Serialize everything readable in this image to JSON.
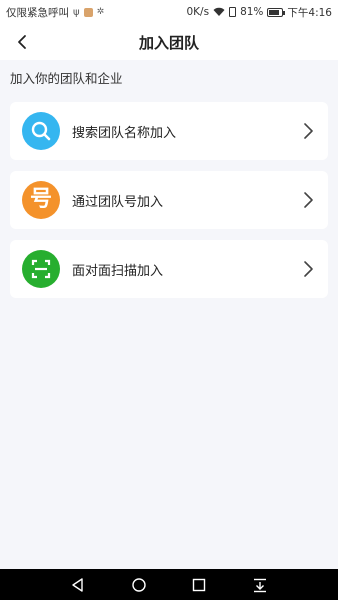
{
  "status_bar": {
    "carrier_text": "仅限紧急呼叫",
    "net_speed": "0K/s",
    "battery_percent": "81%",
    "time": "下午4:16"
  },
  "header": {
    "title": "加入团队"
  },
  "section": {
    "label": "加入你的团队和企业"
  },
  "options": [
    {
      "label": "搜索团队名称加入",
      "icon": "search-icon",
      "color": "#35b6f0"
    },
    {
      "label": "通过团队号加入",
      "icon": "number-icon",
      "icon_glyph": "号",
      "color": "#f4922b"
    },
    {
      "label": "面对面扫描加入",
      "icon": "scan-icon",
      "color": "#27ae2f"
    }
  ],
  "nav": {
    "back": "back-triangle-icon",
    "home": "home-circle-icon",
    "recents": "recents-square-icon",
    "menu": "download-menu-icon"
  }
}
